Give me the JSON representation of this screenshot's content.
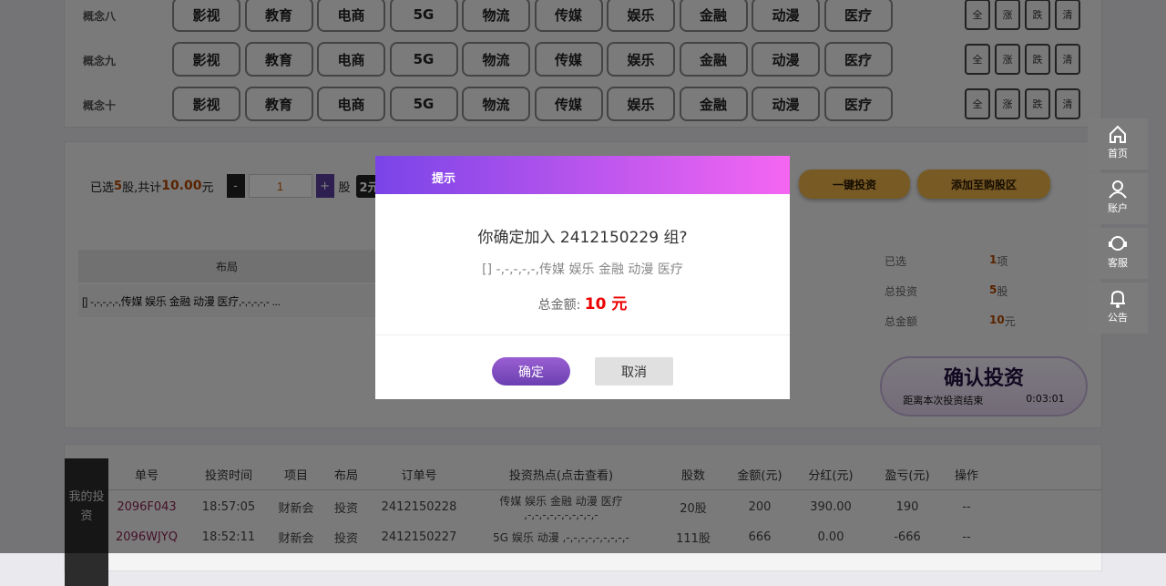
{
  "concepts": [
    {
      "label": "概念八",
      "items": [
        "影视",
        "教育",
        "电商",
        "5G",
        "物流",
        "传媒",
        "娱乐",
        "金融",
        "动漫",
        "医疗"
      ]
    },
    {
      "label": "概念九",
      "items": [
        "影视",
        "教育",
        "电商",
        "5G",
        "物流",
        "传媒",
        "娱乐",
        "金融",
        "动漫",
        "医疗"
      ]
    },
    {
      "label": "概念十",
      "items": [
        "影视",
        "教育",
        "电商",
        "5G",
        "物流",
        "传媒",
        "娱乐",
        "金融",
        "动漫",
        "医疗"
      ]
    }
  ],
  "quick_select": [
    "全",
    "涨",
    "跌",
    "清"
  ],
  "bar": {
    "prefix": "已选",
    "count": "5",
    "mid": "股,共计",
    "total": "10.00",
    "suffix": "元",
    "qty": "1",
    "unit": "股",
    "chip": "2元",
    "one_click": "一键投资",
    "add_cart": "添加至购股区"
  },
  "layout_table": {
    "header": "布局",
    "row": "[] -,-,-,-,-,传媒 娱乐 金融 动漫 医疗,-,-,-,-,- ..."
  },
  "stats": [
    {
      "label": "已选",
      "value": "1",
      "unit": "项"
    },
    {
      "label": "总投资",
      "value": "5",
      "unit": "股"
    },
    {
      "label": "总金额",
      "value": "10",
      "unit": "元"
    }
  ],
  "confirm": {
    "title": "确认投资",
    "countdown_label": "距离本次投资结束",
    "countdown": "0:03:01"
  },
  "my_invest": {
    "tab": "我的投资",
    "headers": [
      "单号",
      "投资时间",
      "项目",
      "布局",
      "订单号",
      "投资热点(点击查看)",
      "股数",
      "金额(元)",
      "分红(元)",
      "盈亏(元)",
      "操作"
    ],
    "rows": [
      [
        "2096F043",
        "18:57:05",
        "财新会",
        "投资",
        "2412150228",
        "传媒 娱乐 金融 动漫 医疗 ,-,-,-,-,-,-,-,-,-,-",
        "20股",
        "200",
        "390.00",
        "190",
        "--"
      ],
      [
        "2096WJYQ",
        "18:52:11",
        "财新会",
        "投资",
        "2412150227",
        "5G 娱乐 动漫 ,-,-,-,-,-,-,-,-,-",
        "111股",
        "666",
        "0.00",
        "-666",
        "--"
      ]
    ]
  },
  "modal": {
    "title": "提示",
    "question": "你确定加入 2412150229 组?",
    "detail": "[] -,-,-,-,-,传媒 娱乐 金融 动漫 医疗",
    "amount_label": "总金额:",
    "amount": "10 元",
    "ok": "确定",
    "cancel": "取消"
  },
  "side_nav": [
    {
      "label": "首页",
      "icon": "home-icon"
    },
    {
      "label": "账户",
      "icon": "user-icon"
    },
    {
      "label": "客服",
      "icon": "headset-icon"
    },
    {
      "label": "公告",
      "icon": "bell-icon"
    }
  ],
  "colors": {
    "accent": "#7a44e8",
    "accent_end": "#f566f2",
    "amount": "#ee0000",
    "highlight": "#c55a00"
  }
}
